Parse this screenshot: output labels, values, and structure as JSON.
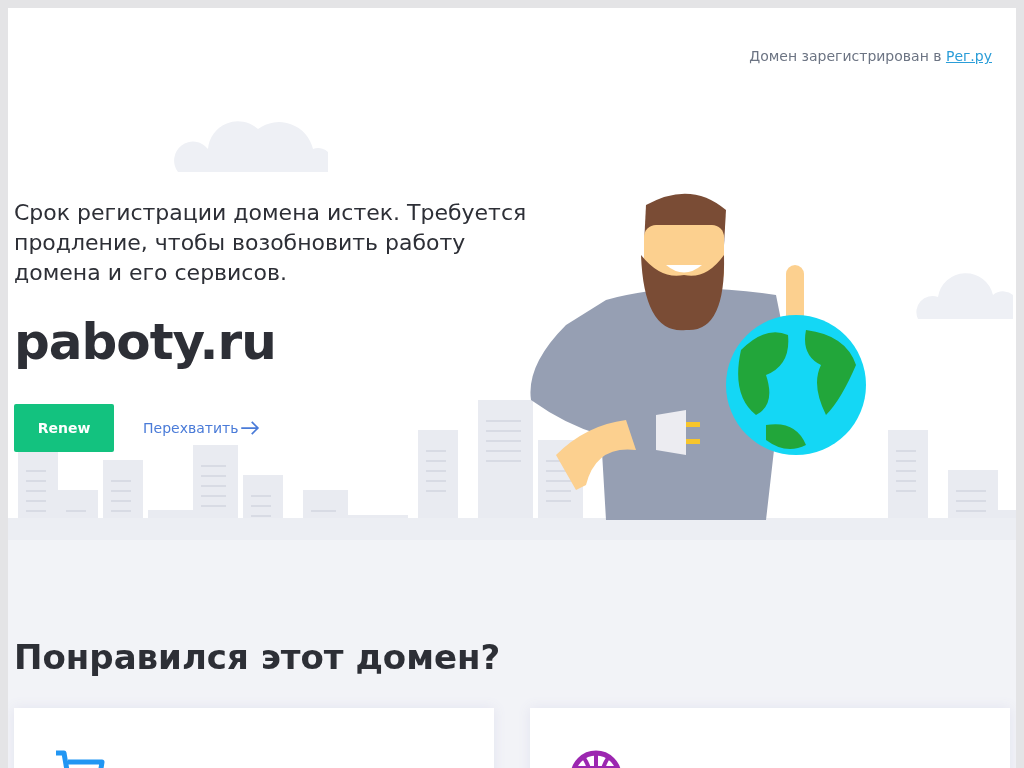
{
  "header": {
    "text": "Домен зарегистрирован в",
    "link": "Рег.ру"
  },
  "message": "Срок регистрации домена истек. Требуется продление, чтобы возобновить работу домена и его сервисов.",
  "domain": "paboty.ru",
  "renew_button": "Renew",
  "intercept_link": "Перехватить",
  "section_title": "Понравился этот домен?",
  "cards": [
    {
      "kind": "cart"
    },
    {
      "kind": "globe"
    }
  ]
}
